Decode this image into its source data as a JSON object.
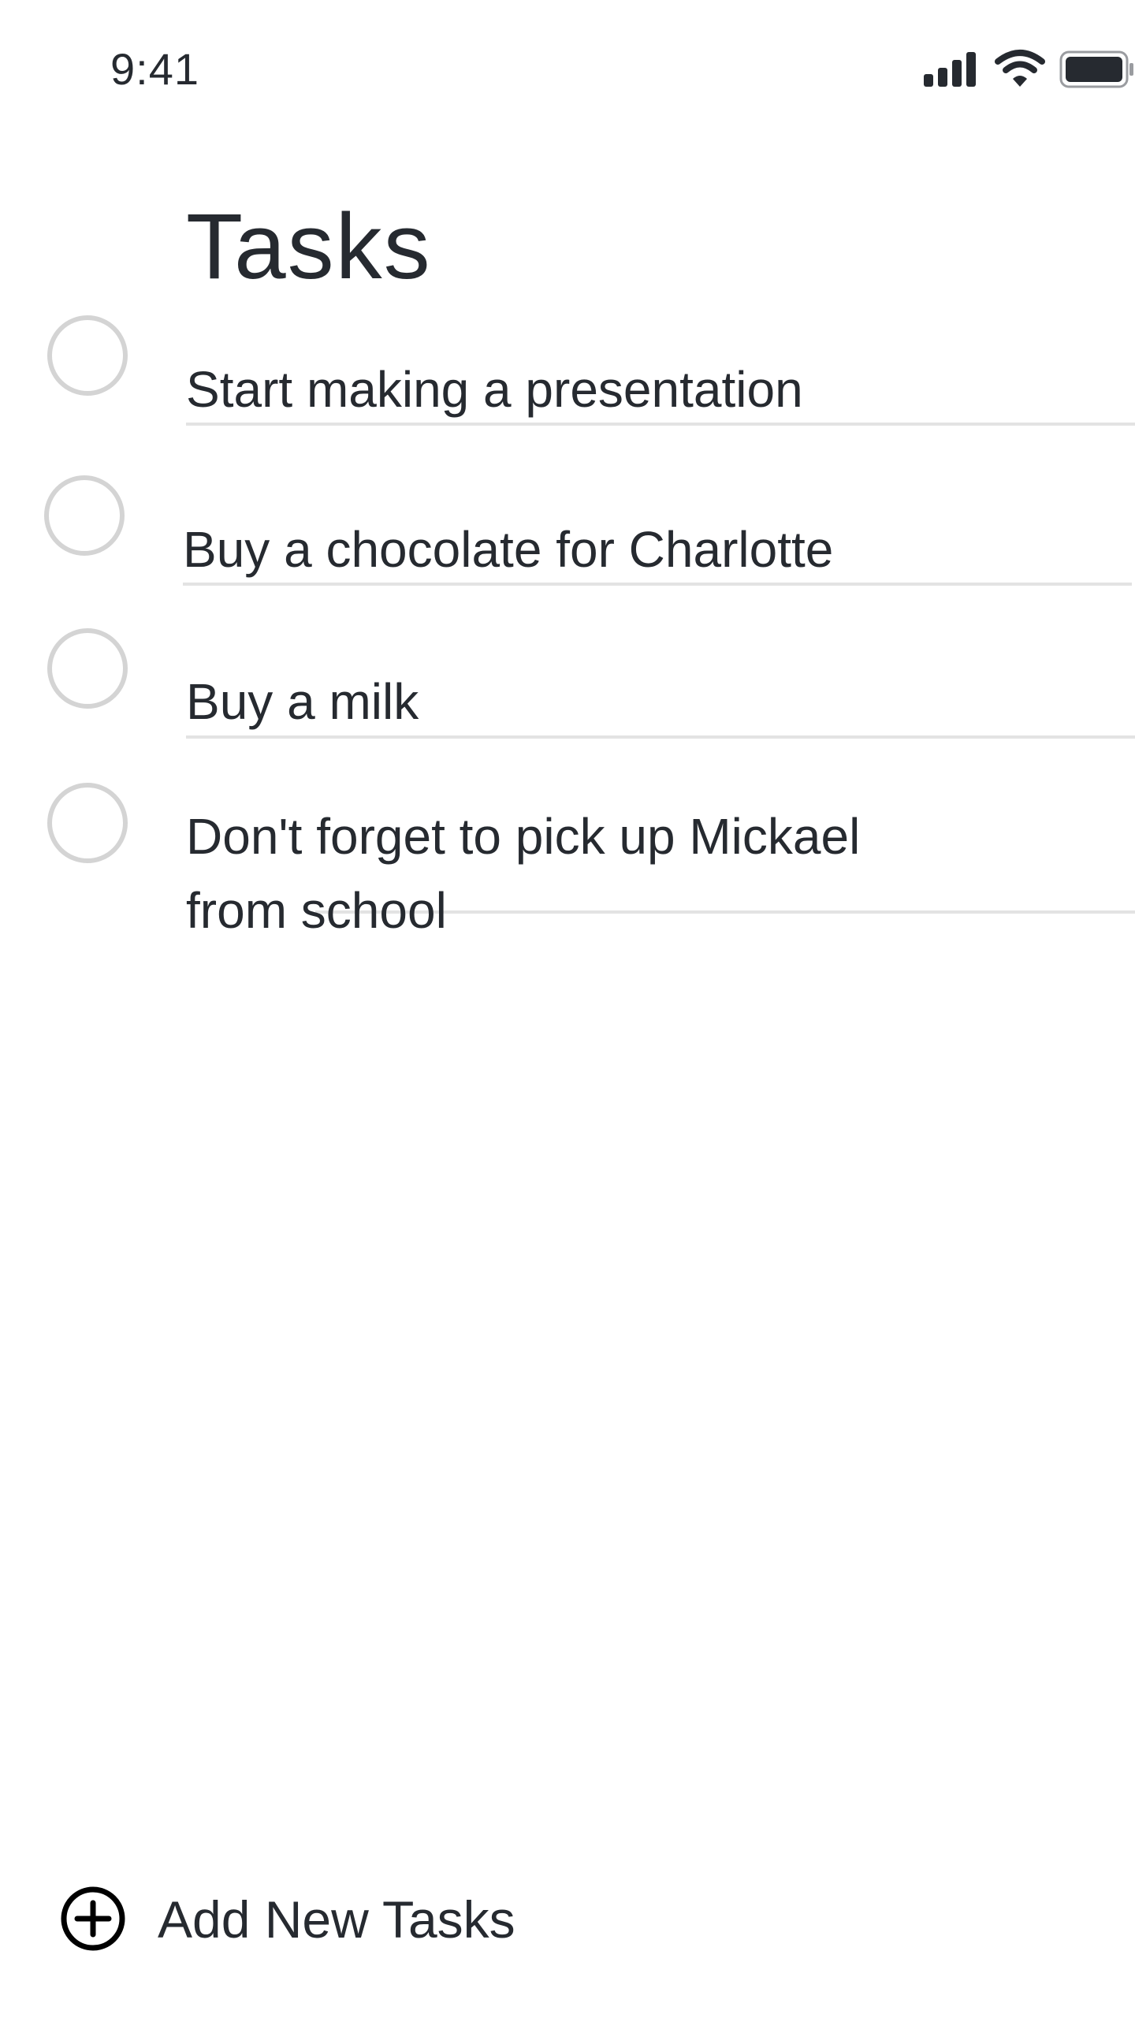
{
  "status_bar": {
    "time": "9:41",
    "icons": [
      "signal-icon",
      "wifi-icon",
      "battery-icon"
    ]
  },
  "page": {
    "title": "Tasks"
  },
  "tasks": [
    {
      "label": "Start making a presentation",
      "completed": false
    },
    {
      "label": "Buy a chocolate for Charlotte",
      "completed": false
    },
    {
      "label": "Buy a milk",
      "completed": false
    },
    {
      "label": "Don't forget to pick up Mickael from school",
      "completed": false
    }
  ],
  "add_task": {
    "label": "Add New Tasks",
    "icon": "plus-circle-icon"
  },
  "colors": {
    "text": "#262a30",
    "checkbox_border": "#d4d4d4",
    "divider": "#e3e3e3",
    "background": "#ffffff"
  }
}
